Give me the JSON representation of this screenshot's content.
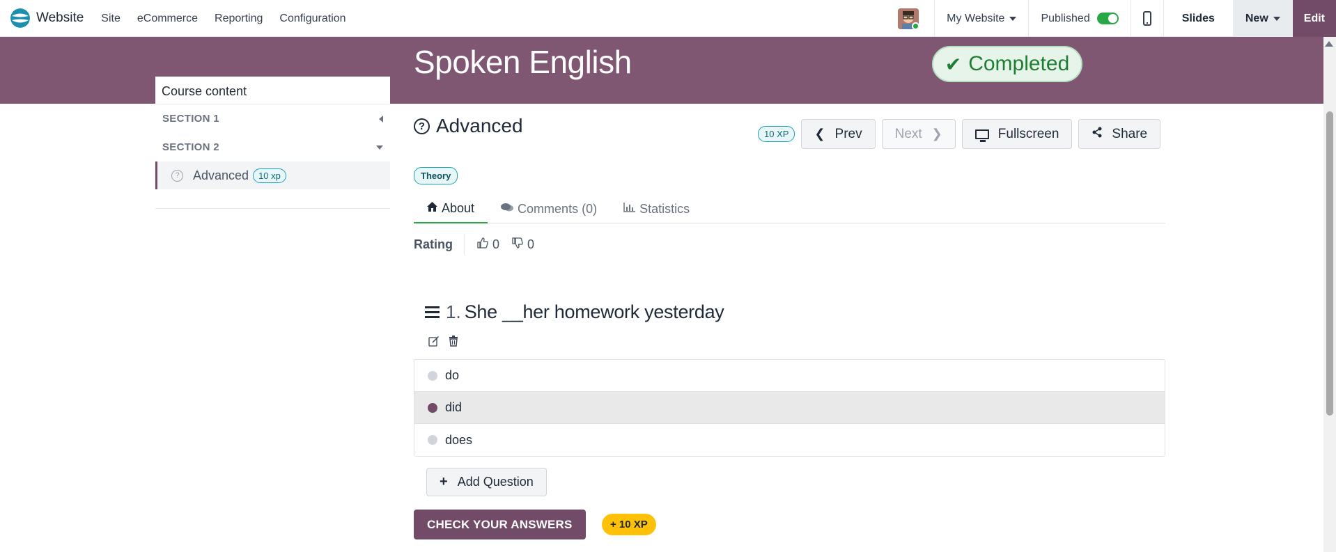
{
  "topbar": {
    "brand": "Website",
    "menu": [
      "Site",
      "eCommerce",
      "Reporting",
      "Configuration"
    ],
    "my_website": "My Website",
    "published": "Published",
    "slides": "Slides",
    "new": "New",
    "edit": "Edit"
  },
  "banner": {
    "course_title": "Spoken English",
    "status": "Completed"
  },
  "sidebar": {
    "header": "Course content",
    "section1": "SECTION 1",
    "section2": "SECTION 2",
    "item": {
      "label": "Advanced",
      "xp": "10 xp"
    }
  },
  "content": {
    "title": "Advanced",
    "xp_badge": "10 XP",
    "prev": "Prev",
    "next": "Next",
    "fullscreen": "Fullscreen",
    "share": "Share",
    "tag": "Theory",
    "tabs": {
      "about": "About",
      "comments": "Comments (0)",
      "statistics": "Statistics"
    },
    "rating": {
      "label": "Rating",
      "likes": "0",
      "dislikes": "0"
    },
    "question": {
      "number": "1.",
      "text": "She __her homework yesterday",
      "answers": [
        "do",
        "did",
        "does"
      ],
      "selected_index": 1
    },
    "add_question": "Add Question",
    "check_answers": "CHECK YOUR ANSWERS",
    "xp_gain": "+ 10 XP"
  },
  "colors": {
    "brand_purple": "#714b67",
    "banner": "#7f5772",
    "success": "#28a745"
  }
}
